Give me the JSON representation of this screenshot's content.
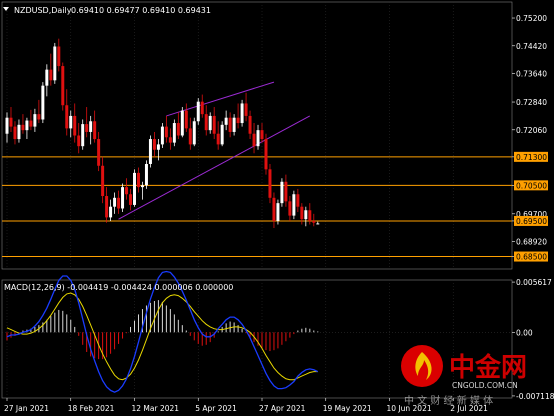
{
  "colors": {
    "background": "#000000",
    "grid": "#2a2a2a",
    "axis_text": "#ffffff",
    "bull_candle": "#ffffff",
    "bear_candle": "#e01010",
    "hline": "#ffa000",
    "trendline": "#9b2bd3",
    "macd_positive": "#d8d8d8",
    "macd_negative": "#e01010",
    "signal": "#e8d800",
    "macd_line": "#1a3cff",
    "watermark_red": "#e60000"
  },
  "chart_data": [
    {
      "type": "candlestick",
      "title": "NZDUSD,Daily",
      "ohlc_text": "0.69410 0.69477 0.69410 0.69431",
      "ylim": [
        0.6815,
        0.7565
      ],
      "y_ticks": [
        "0.75200",
        "0.74420",
        "0.73640",
        "0.72840",
        "0.72060",
        "0.71300",
        "0.70500",
        "0.69700",
        "0.69500",
        "0.68920",
        "0.68500"
      ],
      "y_tick_values": [
        0.752,
        0.7442,
        0.7364,
        0.7284,
        0.7206,
        0.713,
        0.705,
        0.697,
        0.695,
        0.6892,
        0.685
      ],
      "highlighted_levels": [
        "0.71300",
        "0.70500",
        "0.69500",
        "0.68500"
      ],
      "highlighted_values": [
        0.713,
        0.705,
        0.695,
        0.685
      ],
      "x_ticks": [
        "27 Jan 2021",
        "18 Feb 2021",
        "12 Mar 2021",
        "5 Apr 2021",
        "27 Apr 2021",
        "19 May 2021",
        "10 Jun 2021",
        "2 Jul 2021"
      ],
      "x_tick_index": [
        0,
        16,
        32,
        48,
        64,
        80,
        96,
        112
      ],
      "candles": [
        [
          0.7195,
          0.7255,
          0.717,
          0.724
        ],
        [
          0.724,
          0.727,
          0.72,
          0.7215
        ],
        [
          0.7215,
          0.723,
          0.7165,
          0.718
        ],
        [
          0.718,
          0.7235,
          0.717,
          0.722
        ],
        [
          0.722,
          0.725,
          0.7195,
          0.7205
        ],
        [
          0.7205,
          0.724,
          0.718,
          0.7232
        ],
        [
          0.7232,
          0.7262,
          0.7205,
          0.7215
        ],
        [
          0.7215,
          0.7265,
          0.72,
          0.725
        ],
        [
          0.725,
          0.729,
          0.7225,
          0.7235
        ],
        [
          0.7235,
          0.734,
          0.7225,
          0.733
        ],
        [
          0.733,
          0.739,
          0.73,
          0.7375
        ],
        [
          0.7375,
          0.742,
          0.733,
          0.7345
        ],
        [
          0.7345,
          0.745,
          0.7335,
          0.744
        ],
        [
          0.744,
          0.7462,
          0.737,
          0.7385
        ],
        [
          0.7385,
          0.7395,
          0.726,
          0.7275
        ],
        [
          0.7275,
          0.732,
          0.719,
          0.721
        ],
        [
          0.721,
          0.726,
          0.7185,
          0.7245
        ],
        [
          0.7245,
          0.728,
          0.717,
          0.719
        ],
        [
          0.719,
          0.7225,
          0.714,
          0.716
        ],
        [
          0.716,
          0.7235,
          0.715,
          0.7222
        ],
        [
          0.7222,
          0.727,
          0.7185,
          0.72
        ],
        [
          0.72,
          0.7245,
          0.7165,
          0.723
        ],
        [
          0.723,
          0.726,
          0.717,
          0.718
        ],
        [
          0.718,
          0.72,
          0.709,
          0.7105
        ],
        [
          0.7105,
          0.713,
          0.7,
          0.702
        ],
        [
          0.702,
          0.7045,
          0.6945,
          0.696
        ],
        [
          0.696,
          0.701,
          0.695,
          0.699
        ],
        [
          0.699,
          0.703,
          0.697,
          0.7015
        ],
        [
          0.7015,
          0.7035,
          0.697,
          0.6985
        ],
        [
          0.6985,
          0.7055,
          0.6975,
          0.7045
        ],
        [
          0.7045,
          0.707,
          0.701,
          0.7025
        ],
        [
          0.7025,
          0.704,
          0.698,
          0.6995
        ],
        [
          0.6995,
          0.7095,
          0.699,
          0.7085
        ],
        [
          0.7085,
          0.71,
          0.703,
          0.7045
        ],
        [
          0.7045,
          0.706,
          0.701,
          0.705
        ],
        [
          0.705,
          0.712,
          0.704,
          0.711
        ],
        [
          0.711,
          0.719,
          0.71,
          0.718
        ],
        [
          0.718,
          0.72,
          0.713,
          0.715
        ],
        [
          0.715,
          0.718,
          0.712,
          0.7165
        ],
        [
          0.7165,
          0.7225,
          0.7155,
          0.7215
        ],
        [
          0.7215,
          0.7245,
          0.717,
          0.7185
        ],
        [
          0.7185,
          0.721,
          0.715,
          0.717
        ],
        [
          0.717,
          0.7235,
          0.716,
          0.7225
        ],
        [
          0.7225,
          0.7255,
          0.718,
          0.719
        ],
        [
          0.719,
          0.727,
          0.7185,
          0.726
        ],
        [
          0.726,
          0.728,
          0.72,
          0.721
        ],
        [
          0.721,
          0.724,
          0.715,
          0.7165
        ],
        [
          0.7165,
          0.724,
          0.716,
          0.723
        ],
        [
          0.723,
          0.7295,
          0.722,
          0.7285
        ],
        [
          0.7285,
          0.7305,
          0.724,
          0.725
        ],
        [
          0.725,
          0.7275,
          0.719,
          0.7205
        ],
        [
          0.7205,
          0.7255,
          0.7195,
          0.7245
        ],
        [
          0.7245,
          0.727,
          0.718,
          0.7195
        ],
        [
          0.7195,
          0.723,
          0.715,
          0.7165
        ],
        [
          0.7165,
          0.723,
          0.716,
          0.722
        ],
        [
          0.722,
          0.726,
          0.7205,
          0.724
        ],
        [
          0.724,
          0.7255,
          0.7185,
          0.72
        ],
        [
          0.72,
          0.725,
          0.719,
          0.724
        ],
        [
          0.724,
          0.728,
          0.721,
          0.7225
        ],
        [
          0.7225,
          0.729,
          0.7215,
          0.728
        ],
        [
          0.728,
          0.731,
          0.723,
          0.7245
        ],
        [
          0.7245,
          0.726,
          0.718,
          0.7195
        ],
        [
          0.7195,
          0.7225,
          0.714,
          0.716
        ],
        [
          0.716,
          0.722,
          0.715,
          0.7205
        ],
        [
          0.7205,
          0.7225,
          0.717,
          0.718
        ],
        [
          0.718,
          0.7195,
          0.708,
          0.7095
        ],
        [
          0.7095,
          0.711,
          0.7,
          0.7015
        ],
        [
          0.7015,
          0.703,
          0.693,
          0.695
        ],
        [
          0.695,
          0.701,
          0.694,
          0.7
        ],
        [
          0.7,
          0.707,
          0.699,
          0.706
        ],
        [
          0.706,
          0.708,
          0.699,
          0.7005
        ],
        [
          0.7005,
          0.702,
          0.695,
          0.6965
        ],
        [
          0.6965,
          0.7035,
          0.6955,
          0.7025
        ],
        [
          0.7025,
          0.704,
          0.6975,
          0.699
        ],
        [
          0.699,
          0.7,
          0.694,
          0.6955
        ],
        [
          0.6955,
          0.699,
          0.6935,
          0.698
        ],
        [
          0.698,
          0.7,
          0.694,
          0.695
        ],
        [
          0.695,
          0.697,
          0.6935,
          0.6945
        ],
        [
          0.6941,
          0.6948,
          0.6941,
          0.6943
        ]
      ],
      "trendlines": [
        {
          "name": "upper-channel",
          "from": [
            40,
            0.7245
          ],
          "to": [
            67,
            0.734
          ]
        },
        {
          "name": "lower-channel",
          "from": [
            28,
            0.6955
          ],
          "to": [
            76,
            0.7245
          ]
        }
      ]
    },
    {
      "type": "histogram+line",
      "title": "MACD(12,26,9) -0.004419 -0.004424 0.000006 0.000000",
      "ylim": [
        -0.00735,
        0.00585
      ],
      "y_ticks": [
        "0.005617",
        "0.00",
        "-0.007118"
      ],
      "y_tick_values": [
        0.005617,
        0,
        -0.007118
      ],
      "histogram": [
        -0.0009,
        -0.0006,
        -0.0004,
        -0.0001,
        0.0002,
        0.0003,
        0.0004,
        0.0006,
        0.0008,
        0.0011,
        0.0014,
        0.0018,
        0.0022,
        0.0025,
        0.0024,
        0.002,
        0.0014,
        0.0006,
        -0.0004,
        -0.0014,
        -0.0022,
        -0.0027,
        -0.0029,
        -0.003,
        -0.003,
        -0.0028,
        -0.0024,
        -0.0019,
        -0.0013,
        -0.0007,
        -0.0001,
        0.0006,
        0.0013,
        0.002,
        0.0026,
        0.003,
        0.0033,
        0.0035,
        0.0036,
        0.0034,
        0.003,
        0.0026,
        0.002,
        0.0014,
        0.0008,
        0.0002,
        -0.0004,
        -0.0009,
        -0.0013,
        -0.0015,
        -0.0014,
        -0.0011,
        -0.0006,
        0.0001,
        0.0006,
        0.001,
        0.0012,
        0.0011,
        0.0008,
        0.0004,
        -0.0001,
        -0.0006,
        -0.0011,
        -0.0015,
        -0.0018,
        -0.002,
        -0.0021,
        -0.002,
        -0.0018,
        -0.0014,
        -0.001,
        -0.0006,
        -0.0002,
        0.0002,
        0.0004,
        0.0005,
        0.0004,
        0.0002,
        0.0001
      ],
      "signal": [
        0.0005,
        0.0003,
        0.0001,
        -0.0001,
        -0.0002,
        -0.0002,
        -0.0001,
        0.0001,
        0.0004,
        0.0008,
        0.0013,
        0.0019,
        0.0026,
        0.0033,
        0.0039,
        0.0043,
        0.0044,
        0.0042,
        0.0037,
        0.0029,
        0.0019,
        0.0008,
        -0.0003,
        -0.0014,
        -0.0024,
        -0.0033,
        -0.0041,
        -0.0048,
        -0.0052,
        -0.0053,
        -0.0051,
        -0.0047,
        -0.004,
        -0.0031,
        -0.002,
        -0.0008,
        0.0004,
        0.0015,
        0.0025,
        0.0033,
        0.0038,
        0.0041,
        0.0042,
        0.0041,
        0.0038,
        0.0034,
        0.0029,
        0.0023,
        0.0018,
        0.0013,
        0.0009,
        0.0006,
        0.0004,
        0.0003,
        0.0003,
        0.0004,
        0.0005,
        0.0006,
        0.0006,
        0.0005,
        0.0003,
        0.0,
        -0.0005,
        -0.0011,
        -0.0018,
        -0.0026,
        -0.0033,
        -0.004,
        -0.0045,
        -0.0049,
        -0.0052,
        -0.0053,
        -0.0053,
        -0.0051,
        -0.0049,
        -0.0047,
        -0.0045,
        -0.0044,
        -0.0044
      ],
      "macd": [
        -0.0005,
        -0.0003,
        -0.0003,
        -0.0002,
        0.0,
        0.0001,
        0.0003,
        0.0007,
        0.0012,
        0.0019,
        0.0027,
        0.0037,
        0.0048,
        0.0058,
        0.0063,
        0.0063,
        0.0058,
        0.0048,
        0.0033,
        0.0015,
        -0.0003,
        -0.0019,
        -0.0032,
        -0.0044,
        -0.0054,
        -0.0061,
        -0.0065,
        -0.0067,
        -0.0065,
        -0.006,
        -0.0052,
        -0.0041,
        -0.0027,
        -0.0011,
        0.0006,
        0.0022,
        0.0037,
        0.005,
        0.0061,
        0.0067,
        0.0068,
        0.0067,
        0.0062,
        0.0055,
        0.0046,
        0.0036,
        0.0025,
        0.0014,
        0.0005,
        -0.0002,
        -0.0005,
        -0.0005,
        -0.0002,
        0.0004,
        0.0009,
        0.0014,
        0.0017,
        0.0017,
        0.0014,
        0.0009,
        0.0002,
        -0.0006,
        -0.0016,
        -0.0026,
        -0.0036,
        -0.0046,
        -0.0054,
        -0.006,
        -0.0063,
        -0.0063,
        -0.0062,
        -0.0059,
        -0.0055,
        -0.0049,
        -0.0045,
        -0.0042,
        -0.0041,
        -0.0042,
        -0.0044
      ]
    }
  ],
  "watermark": {
    "brand_cn": "中金网",
    "domain": "CNGOLD.COM.CN",
    "slogan_cn": "中 文 财 经 新 媒 体"
  }
}
